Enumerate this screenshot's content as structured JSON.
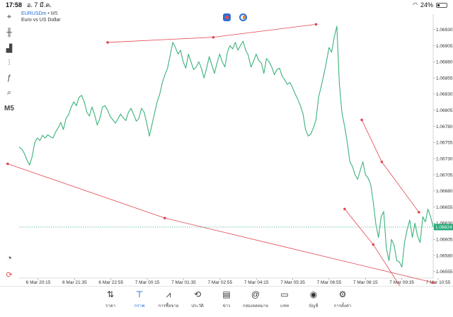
{
  "status_bar": {
    "time": "17:58",
    "date": "อ. 7 มี.ค.",
    "battery": "24%"
  },
  "symbol": {
    "name": "EURUSDm",
    "timeframe": "M5",
    "description": "Euro vs US Dollar"
  },
  "toolbar": {
    "items": [
      {
        "name": "crosshair-icon",
        "glyph": "⌖"
      },
      {
        "name": "candlestick-icon",
        "glyph": "╫"
      },
      {
        "name": "bar-chart-icon",
        "glyph": "▟"
      },
      {
        "name": "indicators-icon",
        "glyph": "⫶"
      },
      {
        "name": "function-icon",
        "glyph": "ƒ"
      },
      {
        "name": "objects-icon",
        "glyph": "⌕"
      }
    ],
    "timeframe_label": "M5",
    "bottom_items": [
      {
        "name": "gauge-icon",
        "glyph": "◔"
      },
      {
        "name": "trade-app-icon",
        "glyph": "⟳"
      }
    ]
  },
  "current_price": "1.06624",
  "colors": {
    "line": "#3bb27a",
    "drawing": "#e2454f",
    "price_tag": "#2aa87a",
    "accent": "#1f6fd1"
  },
  "chart_data": {
    "type": "line",
    "symbol": "EURUSDm",
    "timeframe": "M5",
    "y_ticks": [
      "1.06930",
      "1.06905",
      "1.06880",
      "1.06855",
      "1.06830",
      "1.06805",
      "1.06780",
      "1.06755",
      "1.06730",
      "1.06705",
      "1.06680",
      "1.06655",
      "1.06630",
      "1.06605",
      "1.06580",
      "1.06555"
    ],
    "x_ticks": [
      "6 Mar 20:15",
      "6 Mar 21:35",
      "6 Mar 22:55",
      "7 Mar 00:15",
      "7 Mar 01:35",
      "7 Mar 02:55",
      "7 Mar 04:15",
      "7 Mar 05:35",
      "7 Mar 06:55",
      "7 Mar 08:15",
      "7 Mar 09:35",
      "7 Mar 10:55"
    ],
    "ylim": [
      1.06545,
      1.06945
    ],
    "x_range_bars": [
      0,
      145
    ],
    "series": [
      {
        "values": [
          1.06748,
          1.06745,
          1.06738,
          1.06728,
          1.0672,
          1.06733,
          1.06755,
          1.06762,
          1.06758,
          1.06766,
          1.06762,
          1.06767,
          1.06764,
          1.06762,
          1.06771,
          1.06778,
          1.06786,
          1.06775,
          1.06792,
          1.06798,
          1.0681,
          1.06818,
          1.06812,
          1.06825,
          1.06828,
          1.06818,
          1.06802,
          1.06796,
          1.0681,
          1.06798,
          1.06782,
          1.06792,
          1.0681,
          1.06812,
          1.06805,
          1.06795,
          1.0679,
          1.06785,
          1.06792,
          1.06799,
          1.06793,
          1.06789,
          1.06802,
          1.06808,
          1.06798,
          1.06788,
          1.06792,
          1.06808,
          1.06802,
          1.06785,
          1.06765,
          1.06782,
          1.068,
          1.06818,
          1.0683,
          1.06848,
          1.0686,
          1.0687,
          1.0689,
          1.0691,
          1.06902,
          1.06892,
          1.06898,
          1.0688,
          1.0687,
          1.06892,
          1.0688,
          1.06868,
          1.06872,
          1.0688,
          1.0687,
          1.06855,
          1.0687,
          1.06888,
          1.06875,
          1.06862,
          1.06878,
          1.06892,
          1.0688,
          1.06872,
          1.06895,
          1.06905,
          1.069,
          1.0691,
          1.06898,
          1.06905,
          1.06912,
          1.06898,
          1.0689,
          1.06872,
          1.0688,
          1.06892,
          1.06882,
          1.06878,
          1.06862,
          1.06885,
          1.0688,
          1.06872,
          1.0686,
          1.06868,
          1.0687,
          1.06858,
          1.06852,
          1.06845,
          1.06848,
          1.0684,
          1.0683,
          1.06822,
          1.06812,
          1.068,
          1.06775,
          1.06765,
          1.06768,
          1.06778,
          1.0679,
          1.06825,
          1.06842,
          1.0686,
          1.0688,
          1.06902,
          1.06895,
          1.06918,
          1.06935,
          1.06845,
          1.068,
          1.0678,
          1.06755,
          1.06725,
          1.06718,
          1.06705,
          1.06698,
          1.06712,
          1.06725,
          1.06705,
          1.067,
          1.0669,
          1.06662,
          1.06628,
          1.06608,
          1.0664,
          1.06648,
          1.06592,
          1.06572,
          1.06605,
          1.06596,
          1.06572,
          1.0657,
          1.06562,
          1.066,
          1.0662,
          1.06635,
          1.06608,
          1.0663,
          1.0661,
          1.066,
          1.0664,
          1.06632,
          1.06652,
          1.0664,
          1.06624
        ]
      }
    ],
    "drawings": [
      {
        "points": [
          [
            -4,
            1.06722
          ],
          [
            51,
            1.06638
          ],
          [
            145,
            1.06538
          ]
        ]
      },
      {
        "points": [
          [
            31,
            1.0691
          ],
          [
            68,
            1.06918
          ],
          [
            104,
            1.06938
          ]
        ]
      },
      {
        "points": [
          [
            120,
            1.0679
          ],
          [
            127,
            1.06725
          ],
          [
            140,
            1.06647
          ]
        ]
      },
      {
        "points": [
          [
            114,
            1.06652
          ],
          [
            124,
            1.06597
          ],
          [
            134,
            1.06528
          ]
        ]
      }
    ]
  },
  "bottom_nav": {
    "items": [
      {
        "name": "nav-quotes",
        "icon": "⇅",
        "label": "ราคา"
      },
      {
        "name": "nav-chart",
        "icon": "𝍮",
        "label": "กราฟ",
        "active": true
      },
      {
        "name": "nav-trade",
        "icon": "⩘",
        "label": "การซื้อขาย"
      },
      {
        "name": "nav-history",
        "icon": "⟲",
        "label": "ประวัติ"
      },
      {
        "name": "nav-news",
        "icon": "▤",
        "label": "ข่าว"
      },
      {
        "name": "nav-mailbox",
        "icon": "@",
        "label": "กล่องจดหมาย"
      },
      {
        "name": "nav-chat",
        "icon": "▭",
        "label": "แชท"
      },
      {
        "name": "nav-accounts",
        "icon": "◉",
        "label": "บัญชี"
      },
      {
        "name": "nav-settings",
        "icon": "⚙",
        "label": "การตั้งค่า"
      }
    ]
  }
}
